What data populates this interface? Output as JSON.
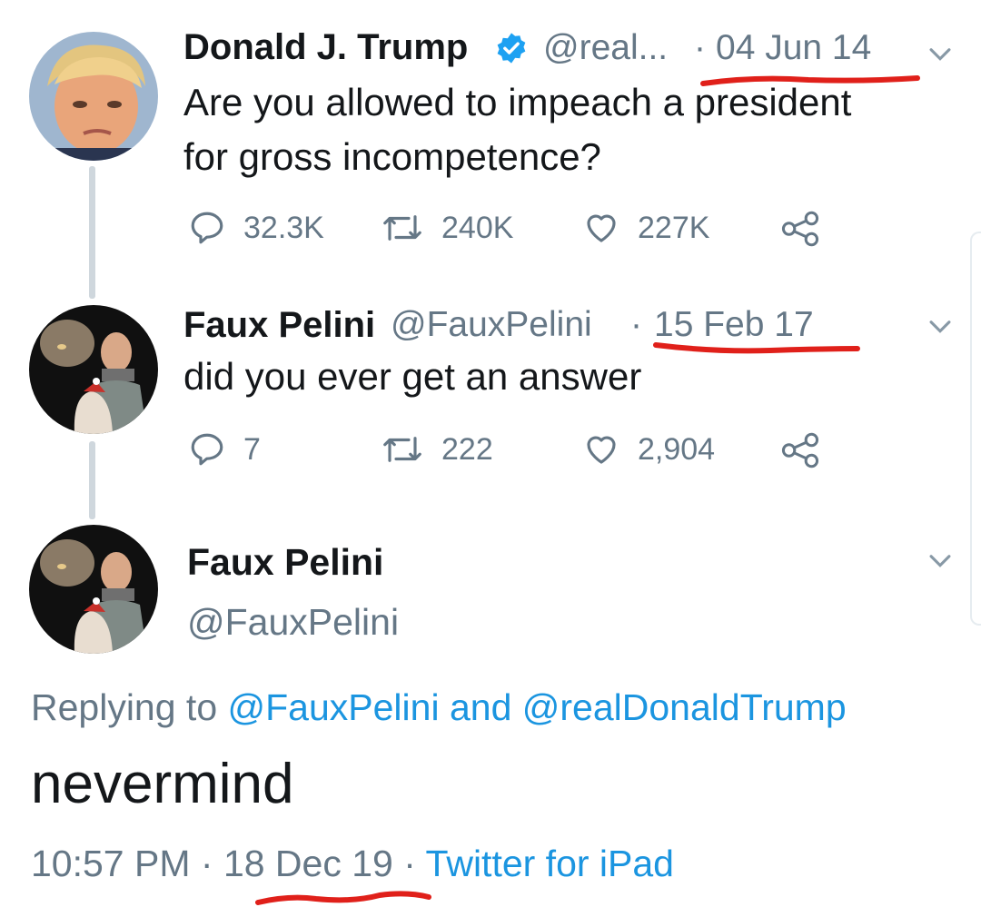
{
  "colors": {
    "text": "#14171a",
    "muted": "#657786",
    "link": "#1b95e0",
    "verified": "#1da1f2",
    "annotation": "#e0201a",
    "thread_line": "#cfd7dd"
  },
  "tweets": [
    {
      "name": "Donald J. Trump",
      "verified": true,
      "handle": "@real...",
      "separator": "·",
      "date": "04 Jun 14",
      "text_line1": "Are you allowed to impeach a president",
      "text_line2": "for gross incompetence?",
      "replies": "32.3K",
      "retweets": "240K",
      "likes": "227K"
    },
    {
      "name": "Faux Pelini",
      "handle": "@FauxPelini",
      "separator": "·",
      "date": "15 Feb 17",
      "text": "did you ever get an answer",
      "replies": "7",
      "retweets": "222",
      "likes": "2,904"
    }
  ],
  "main_tweet": {
    "name": "Faux Pelini",
    "handle": "@FauxPelini",
    "replying_prefix": "Replying to ",
    "reply_user1": "@FauxPelini",
    "reply_and": " and ",
    "reply_user2": "@realDonaldTrump",
    "text": "nevermind",
    "time": "10:57 PM",
    "sep1": " · ",
    "date": "18 Dec 19",
    "sep2": " · ",
    "source": "Twitter for iPad"
  },
  "icons": [
    "reply-icon",
    "retweet-icon",
    "like-icon",
    "share-icon",
    "chevron-down-icon",
    "verified-badge-icon"
  ]
}
